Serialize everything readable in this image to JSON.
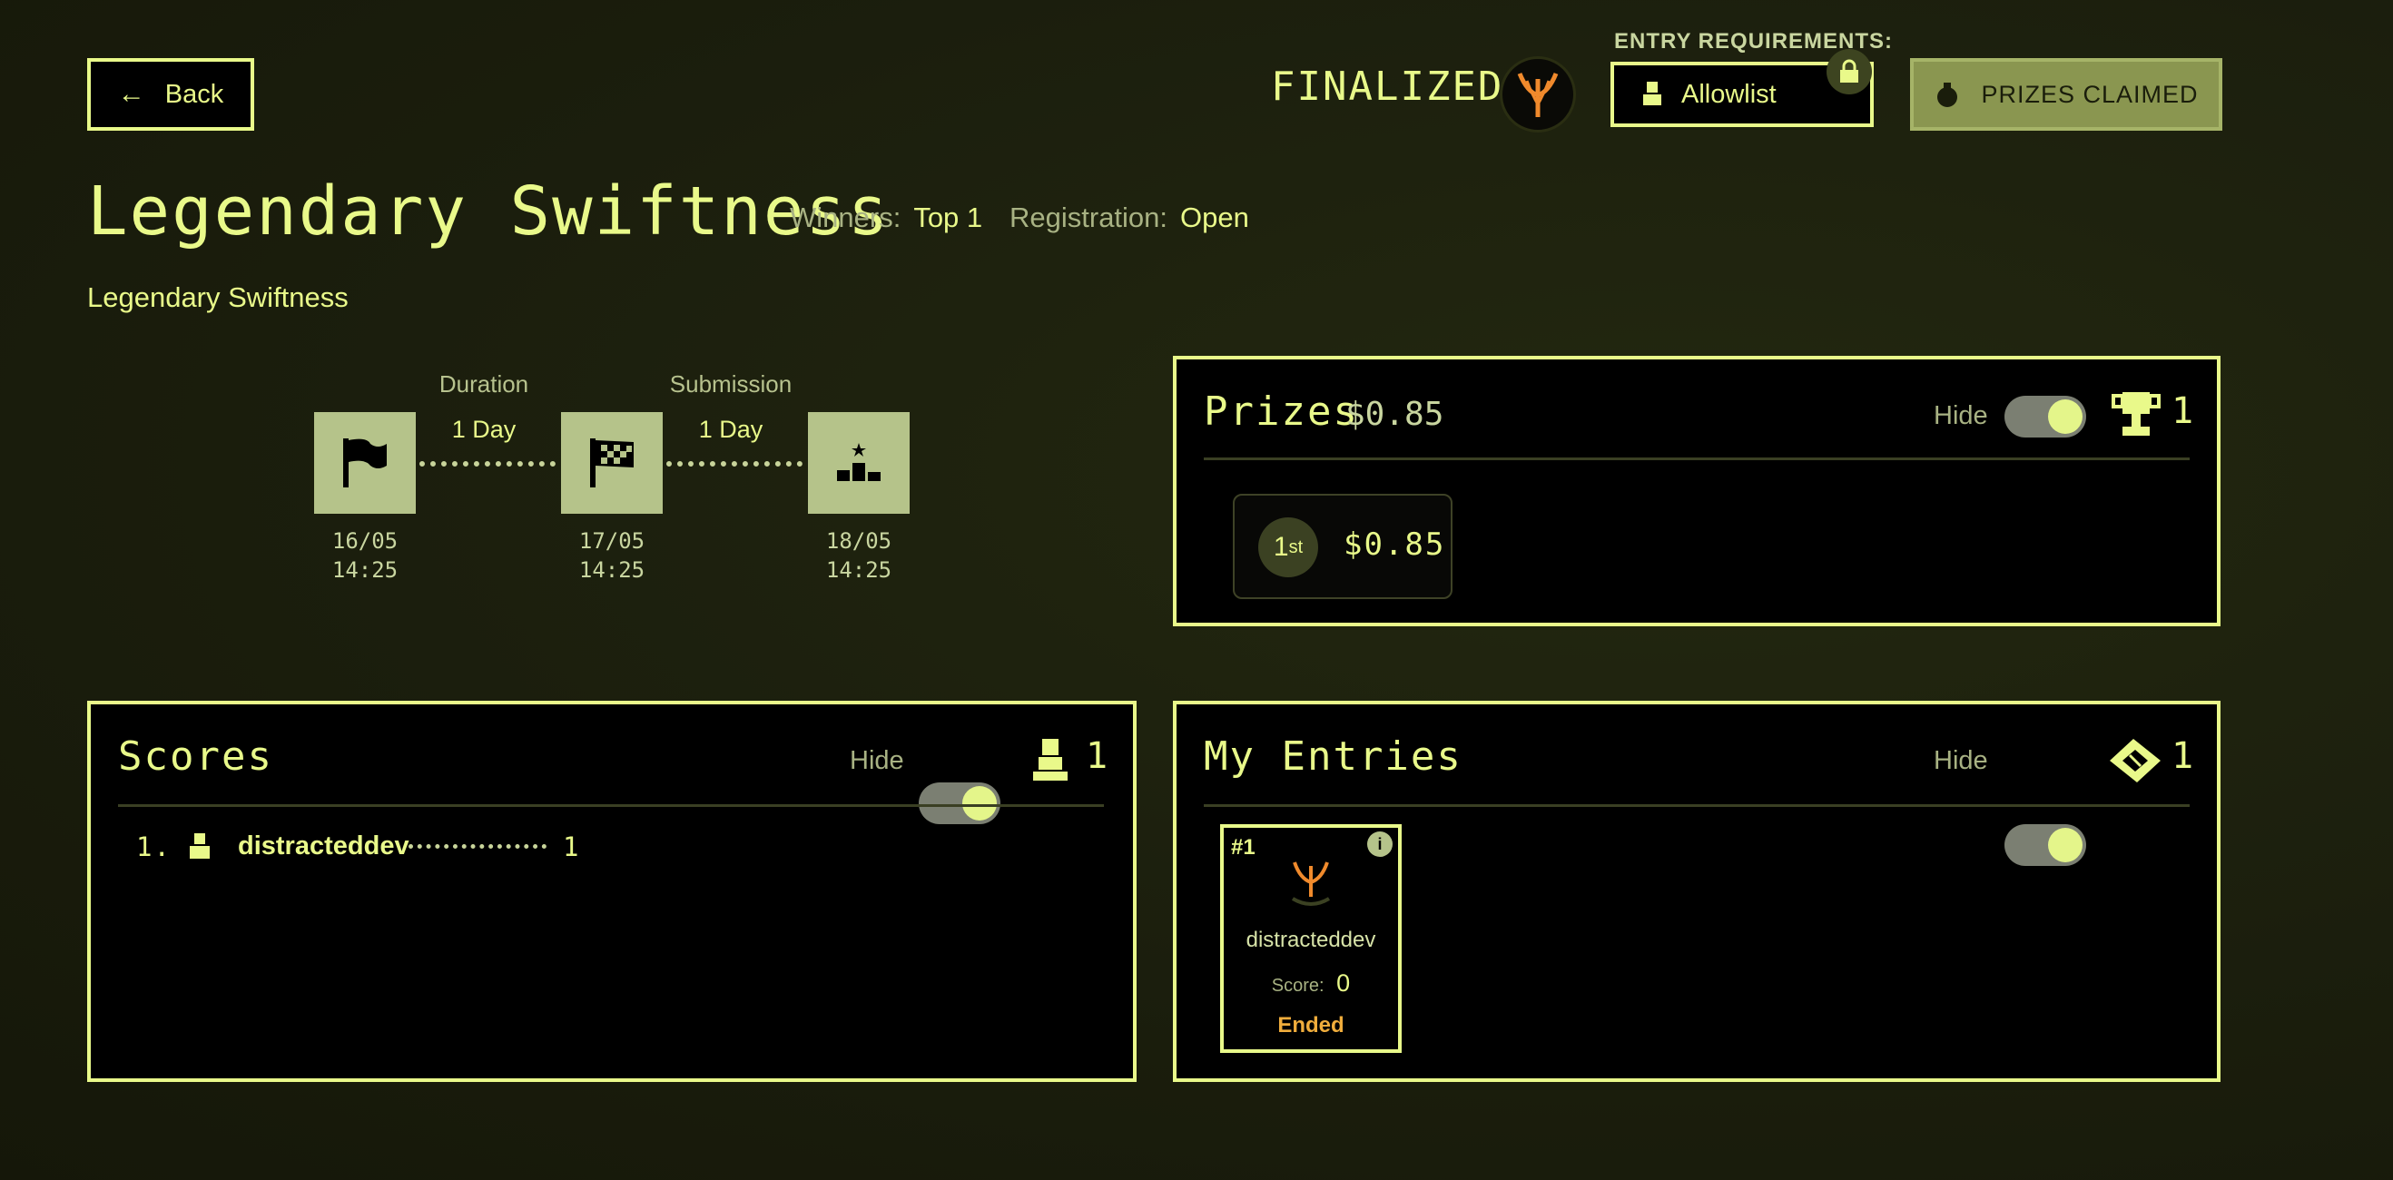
{
  "header": {
    "back_label": "Back",
    "status": "FINALIZED",
    "entry_requirements_label": "ENTRY REQUIREMENTS:",
    "allowlist_label": "Allowlist",
    "prizes_claimed_label": "PRIZES CLAIMED"
  },
  "tournament": {
    "title": "Legendary Swiftness",
    "winners_label": "Winners:",
    "winners_value": "Top 1",
    "registration_label": "Registration:",
    "registration_value": "Open",
    "description": "Legendary Swiftness"
  },
  "timeline": {
    "duration_label": "Duration",
    "duration_value": "1 Day",
    "submission_label": "Submission",
    "submission_value": "1 Day",
    "start_date": "16/05",
    "start_time": "14:25",
    "end_date": "17/05",
    "end_time": "14:25",
    "final_date": "18/05",
    "final_time": "14:25"
  },
  "prizes": {
    "title": "Prizes",
    "total": "$0.85",
    "hide_label": "Hide",
    "count": "1",
    "items": [
      {
        "place": "1",
        "suffix": "st",
        "amount": "$0.85"
      }
    ]
  },
  "scores": {
    "title": "Scores",
    "hide_label": "Hide",
    "count": "1",
    "rows": [
      {
        "rank": "1.",
        "name": "distracteddev",
        "score": "1"
      }
    ]
  },
  "my_entries": {
    "title": "My Entries",
    "hide_label": "Hide",
    "count": "1",
    "entries": [
      {
        "id": "#1",
        "name": "distracteddev",
        "score_label": "Score:",
        "score": "0",
        "status": "Ended"
      }
    ]
  },
  "colors": {
    "accent": "#e9f98a",
    "background": "#1b1e0d",
    "ended": "#f0ad3c",
    "logo_orange": "#f08a2c"
  }
}
